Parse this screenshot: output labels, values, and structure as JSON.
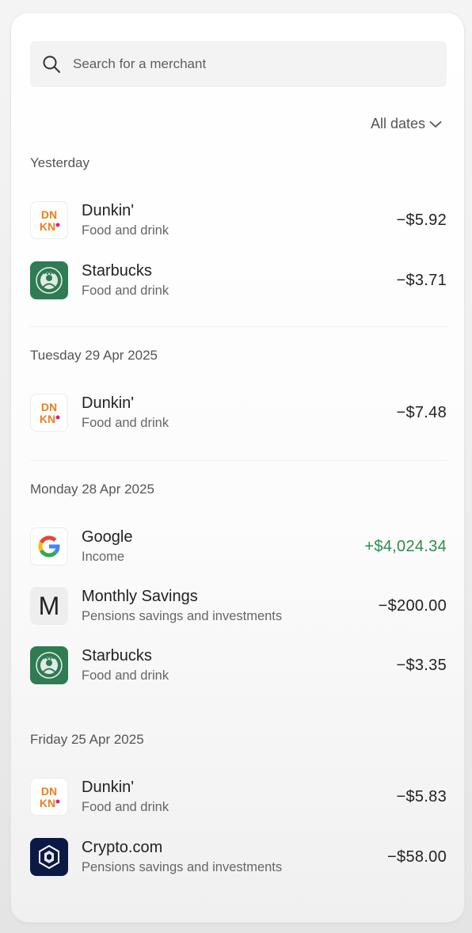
{
  "search": {
    "placeholder": "Search for a merchant"
  },
  "filter": {
    "label": "All dates"
  },
  "colors": {
    "positive": "#2e8b4a",
    "starbucks": "#2f7b52",
    "crypto": "#0b1a45"
  },
  "sections": [
    {
      "title": "Yesterday",
      "transactions": [
        {
          "merchant": "Dunkin'",
          "category": "Food and drink",
          "amount": "−$5.92",
          "icon": "dunkin-logo-icon"
        },
        {
          "merchant": "Starbucks",
          "category": "Food and drink",
          "amount": "−$3.71",
          "icon": "starbucks-logo-icon"
        }
      ]
    },
    {
      "title": "Tuesday 29 Apr 2025",
      "transactions": [
        {
          "merchant": "Dunkin'",
          "category": "Food and drink",
          "amount": "−$7.48",
          "icon": "dunkin-logo-icon"
        }
      ]
    },
    {
      "title": "Monday 28 Apr 2025",
      "transactions": [
        {
          "merchant": "Google",
          "category": "Income",
          "amount": "+$4,024.34",
          "icon": "google-logo-icon"
        },
        {
          "merchant": "Monthly Savings",
          "category": "Pensions savings and investments",
          "amount": "−$200.00",
          "icon": "m-letter-icon",
          "icon_letter": "M"
        },
        {
          "merchant": "Starbucks",
          "category": "Food and drink",
          "amount": "−$3.35",
          "icon": "starbucks-logo-icon"
        }
      ]
    },
    {
      "title": "Friday 25 Apr 2025",
      "transactions": [
        {
          "merchant": "Dunkin'",
          "category": "Food and drink",
          "amount": "−$5.83",
          "icon": "dunkin-logo-icon"
        },
        {
          "merchant": "Crypto.com",
          "category": "Pensions savings and investments",
          "amount": "−$58.00",
          "icon": "crypto-com-logo-icon"
        }
      ]
    }
  ]
}
